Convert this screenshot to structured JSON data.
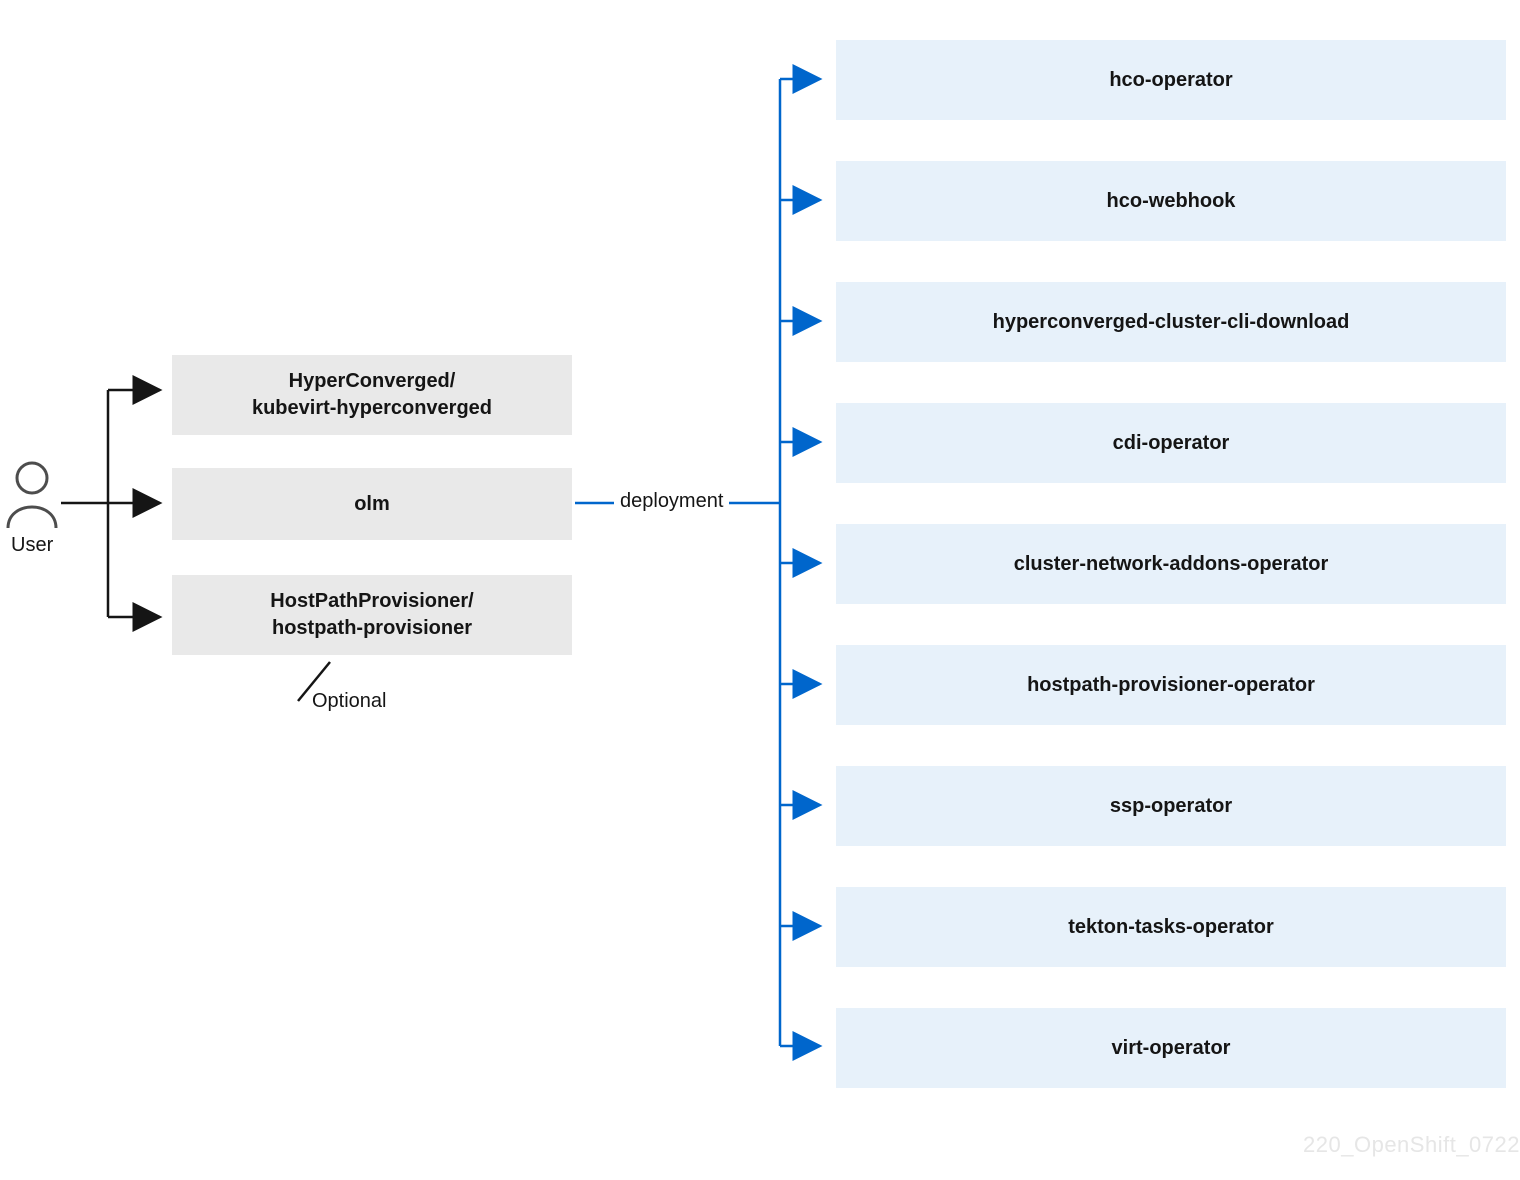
{
  "user_label": "User",
  "gray_boxes": [
    {
      "line1": "HyperConverged/",
      "line2": "kubevirt-hyperconverged"
    },
    {
      "line1": "olm"
    },
    {
      "line1": "HostPathProvisioner/",
      "line2": "hostpath-provisioner"
    }
  ],
  "optional_label": "Optional",
  "deployment_label": "deployment",
  "blue_boxes": [
    "hco-operator",
    "hco-webhook",
    "hyperconverged-cluster-cli-download",
    "cdi-operator",
    "cluster-network-addons-operator",
    "hostpath-provisioner-operator",
    "ssp-operator",
    "tekton-tasks-operator",
    "virt-operator"
  ],
  "watermark": "220_OpenShift_0722",
  "colors": {
    "arrow_black": "#151515",
    "arrow_blue": "#0066cc",
    "box_gray": "#e9e9e9",
    "box_blue": "#e7f1fa"
  }
}
